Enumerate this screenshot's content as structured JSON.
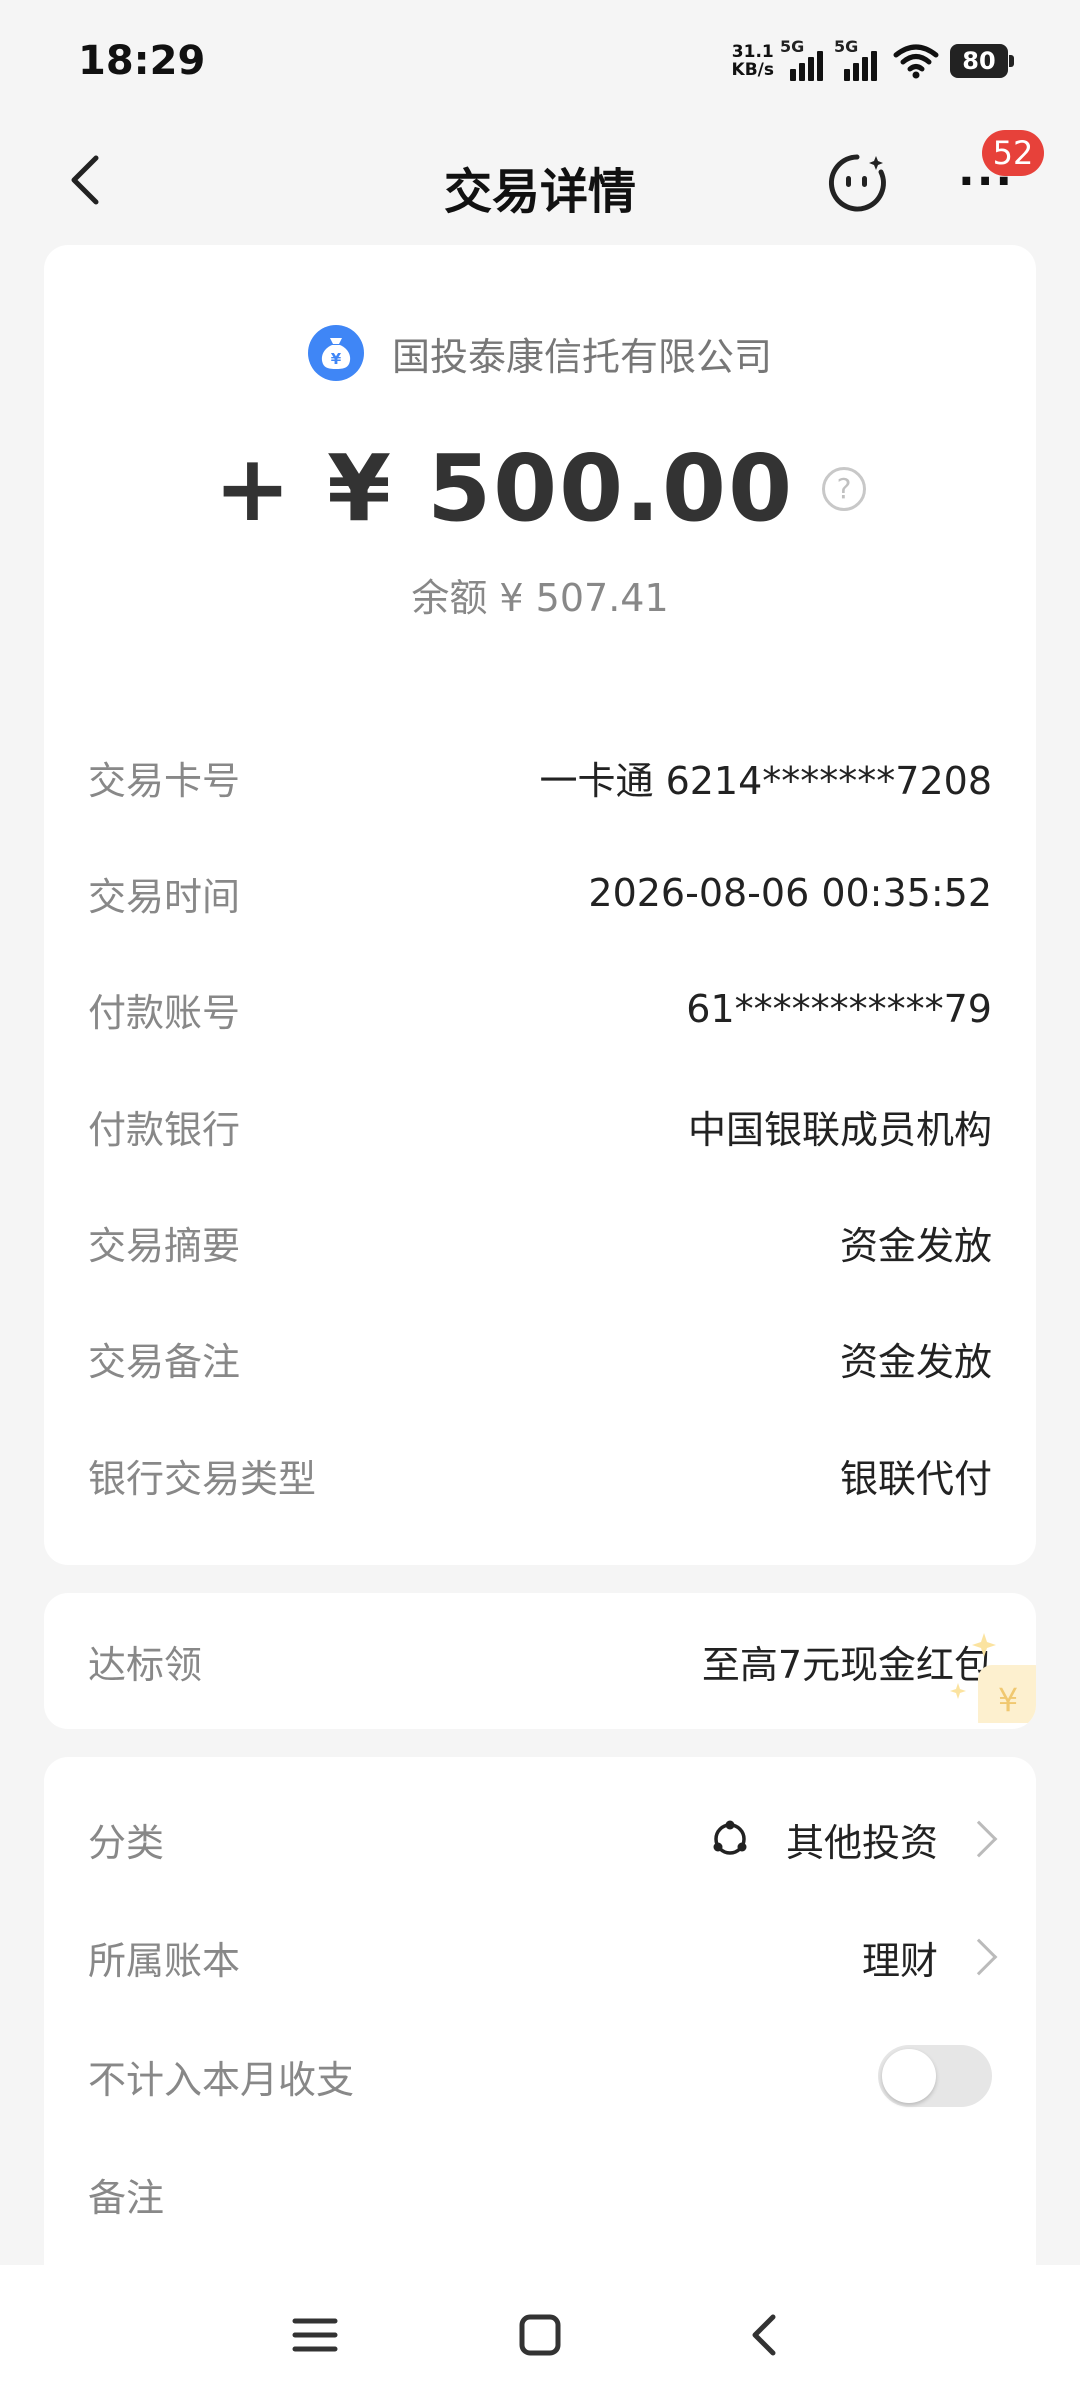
{
  "status_bar": {
    "time": "18:29",
    "net_speed_value": "31.1",
    "net_speed_unit": "KB/s",
    "sim1": "5G",
    "sim2": "5G",
    "battery": "80"
  },
  "header": {
    "title": "交易详情",
    "badge_count": "52",
    "back_icon": "chevron-left-icon",
    "assistant_icon": "smile-icon",
    "more_icon": "more-dots-icon"
  },
  "summary": {
    "merchant": "国投泰康信托有限公司",
    "merchant_icon": "money-bag-icon",
    "amount": "+ ¥ 500.00",
    "balance": "余额 ¥ 507.41",
    "accent_color": "#3f86f6"
  },
  "details": [
    {
      "label": "交易卡号",
      "value": "一卡通 6214*******7208"
    },
    {
      "label": "交易时间",
      "value": "2026-08-06 00:35:52"
    },
    {
      "label": "付款账号",
      "value": "61***********79"
    },
    {
      "label": "付款银行",
      "value": "中国银联成员机构"
    },
    {
      "label": "交易摘要",
      "value": "资金发放"
    },
    {
      "label": "交易备注",
      "value": "资金发放"
    },
    {
      "label": "银行交易类型",
      "value": "银联代付"
    }
  ],
  "promo": {
    "label": "达标领",
    "value": "至高7元现金红包"
  },
  "settings": {
    "category_label": "分类",
    "category_value": "其他投资",
    "ledger_label": "所属账本",
    "ledger_value": "理财",
    "exclude_label": "不计入本月收支",
    "exclude_on": false,
    "note_label": "备注"
  },
  "nav": {
    "menu_icon": "menu-icon",
    "home_icon": "home-square-icon",
    "back_icon": "back-icon"
  }
}
